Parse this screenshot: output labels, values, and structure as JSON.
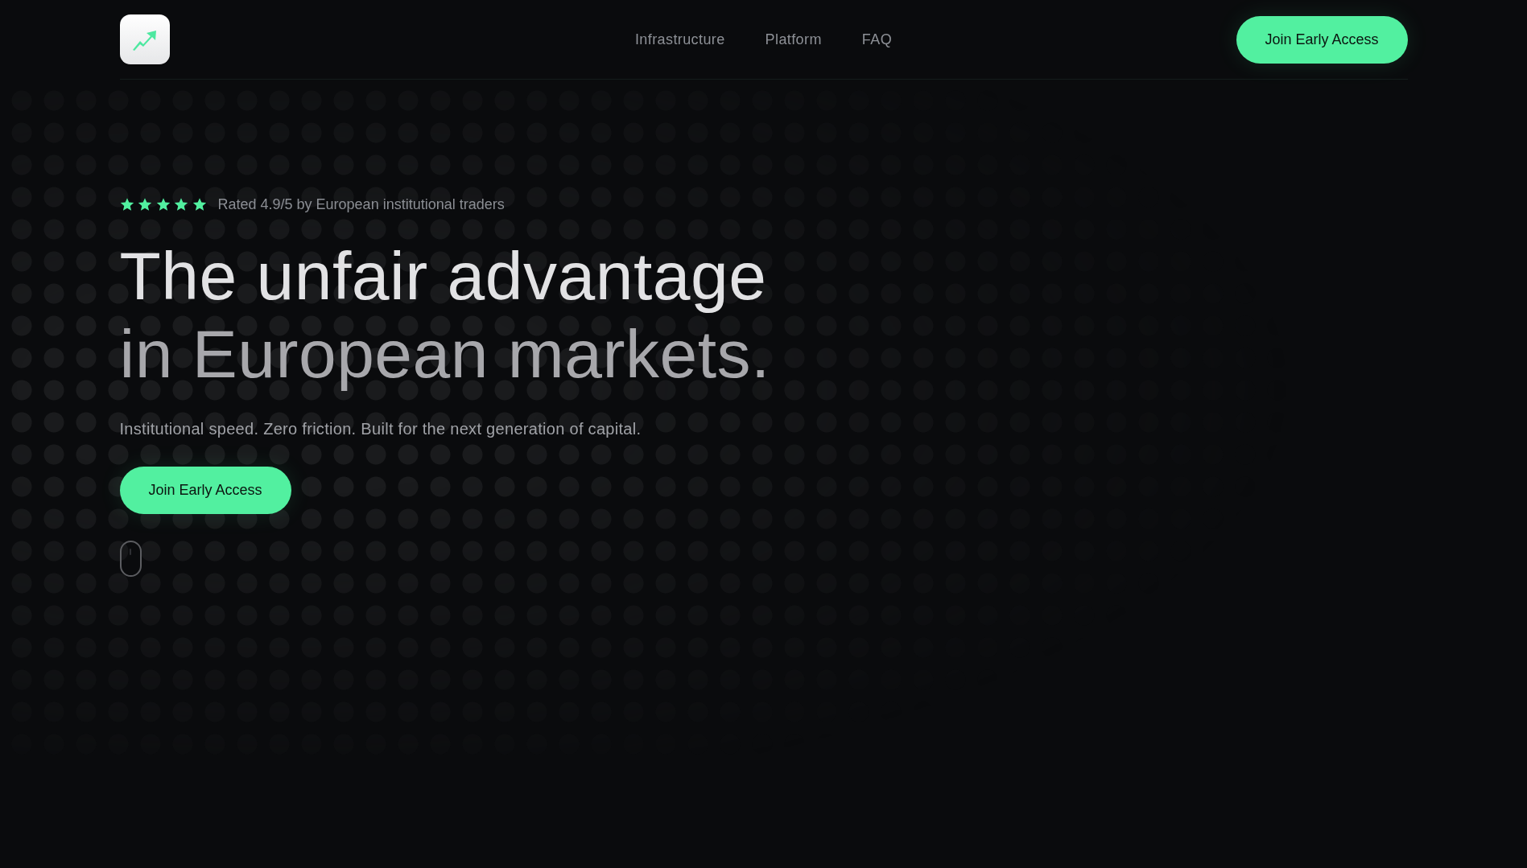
{
  "header": {
    "nav": [
      {
        "label": "Infrastructure"
      },
      {
        "label": "Platform"
      },
      {
        "label": "FAQ"
      }
    ],
    "cta": "Join Early Access"
  },
  "hero": {
    "rating": {
      "stars": 5,
      "text": "Rated 4.9/5 by European institutional traders"
    },
    "title_lines": [
      "The unfair advantage",
      "in European markets."
    ],
    "subtitle": "Institutional speed. Zero friction. Built for the next generation of capital.",
    "cta": "Join Early Access"
  }
}
